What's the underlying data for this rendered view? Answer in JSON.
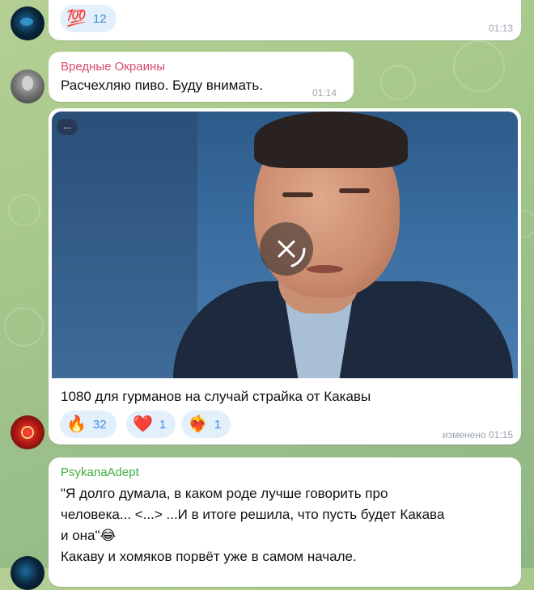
{
  "messages": [
    {
      "reactions": [
        {
          "emoji": "💯",
          "count": "12"
        }
      ],
      "time": "01:13"
    },
    {
      "sender": "Вредные Окраины",
      "sender_color": "#d94a6a",
      "text": "Расчехляю пиво. Буду внимать.",
      "time": "01:14"
    },
    {
      "media_badge": "...",
      "caption": "1080 для гурманов на случай страйка от Какавы",
      "reactions": [
        {
          "emoji": "🔥",
          "count": "32"
        },
        {
          "emoji": "❤️",
          "count": "1"
        },
        {
          "emoji": "❤️‍🔥",
          "count": "1"
        }
      ],
      "time": "изменено 01:15"
    },
    {
      "sender": "PsykanaAdept",
      "sender_color": "#3fae3f",
      "text_lines": [
        "\"Я долго думала, в каком роде лучше говорить про",
        "человека... <...> ...И в итоге решила, что пусть будет Какава",
        "и она\"😂",
        "Какаву и хомяков порвёт уже в самом начале."
      ]
    }
  ],
  "icons": {
    "video_cancel": "close-icon",
    "accent": "#3a8de0",
    "reaction_bg": "#e3effa"
  }
}
